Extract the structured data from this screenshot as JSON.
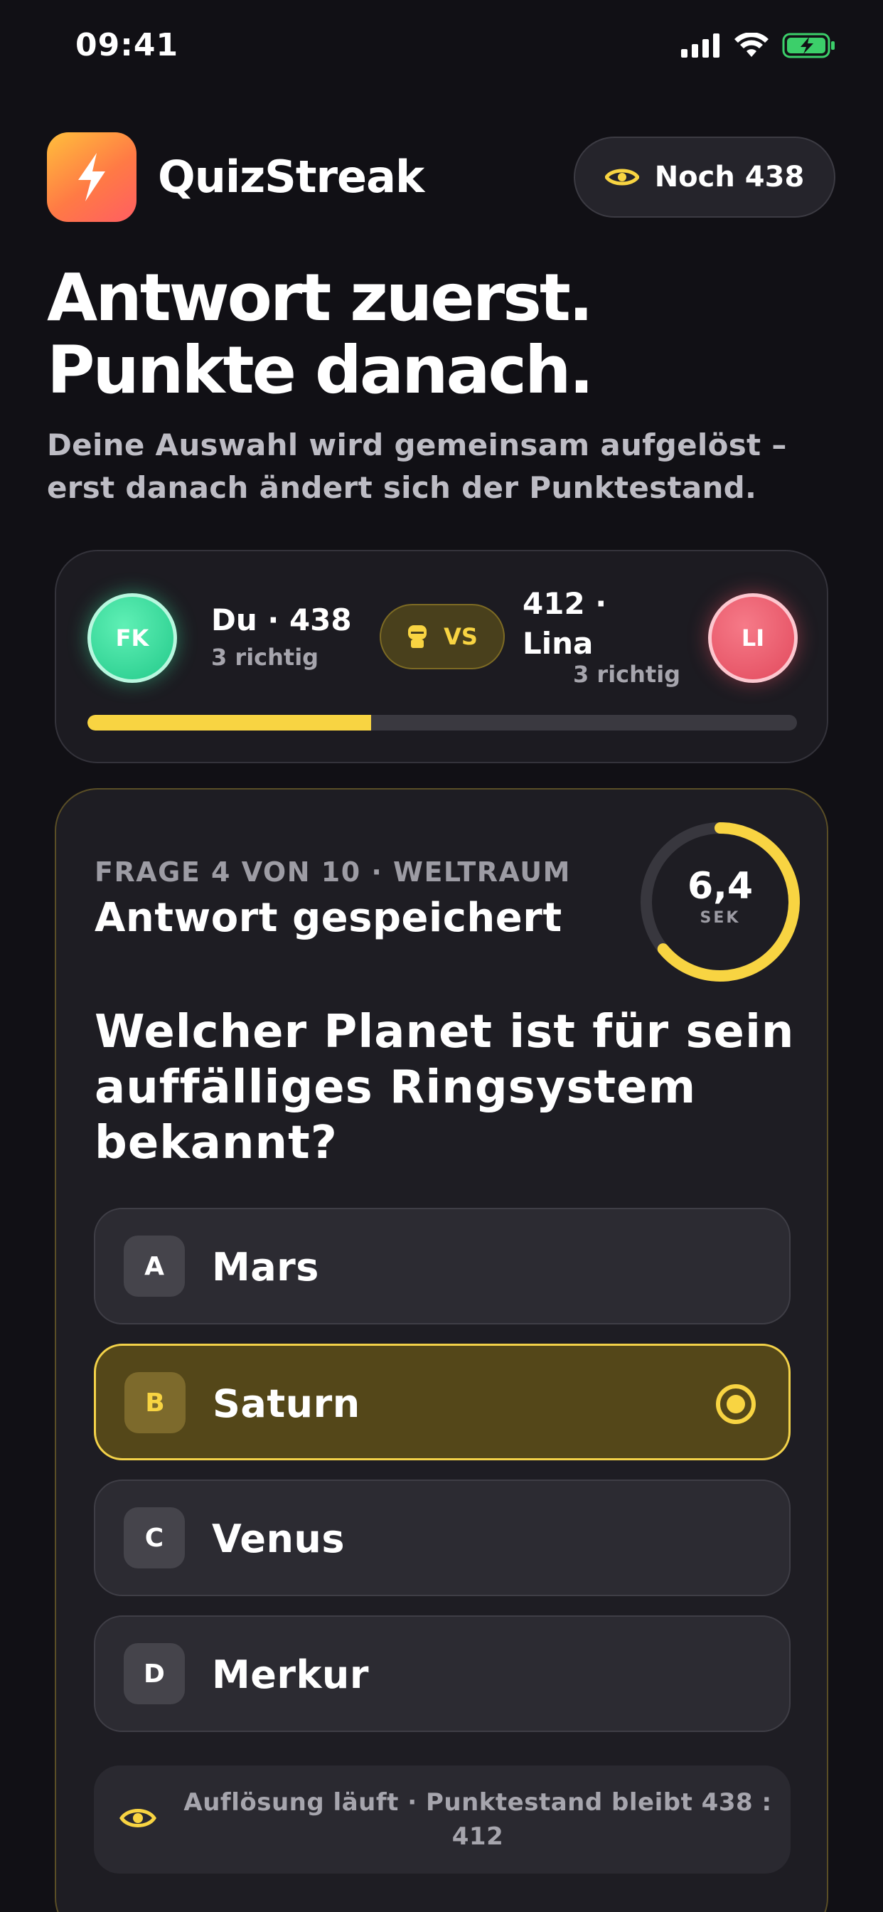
{
  "status_bar": {
    "time": "09:41"
  },
  "header": {
    "app_name": "QuizStreak",
    "remaining_label": "Noch 438"
  },
  "hero": {
    "title": "Antwort zuerst. Punkte danach.",
    "subtitle": "Deine Auswahl wird gemeinsam aufgelöst – erst danach ändert sich der Punktestand."
  },
  "scoreboard": {
    "me": {
      "initials": "FK",
      "name_score": "Du · 438",
      "correct": "3 richtig"
    },
    "vs_label": "VS",
    "opponent": {
      "initials": "LI",
      "name_score": "412 · Lina",
      "correct": "3 richtig"
    },
    "progress_fraction": 0.4,
    "colors": {
      "accent": "#f8d442",
      "me": "#2fd699",
      "opponent": "#ea5668"
    }
  },
  "question": {
    "meta": "FRAGE 4 VON 10 · WELTRAUM",
    "status": "Antwort gespeichert",
    "timer_value": "6,4",
    "timer_unit": "SEK",
    "timer_fraction": 0.64,
    "text": "Welcher Planet ist für sein auffälliges Ringsystem bekannt?",
    "answers": [
      {
        "letter": "A",
        "label": "Mars",
        "selected": false
      },
      {
        "letter": "B",
        "label": "Saturn",
        "selected": true
      },
      {
        "letter": "C",
        "label": "Venus",
        "selected": false
      },
      {
        "letter": "D",
        "label": "Merkur",
        "selected": false
      }
    ],
    "info": "Auflösung läuft · Punktestand bleibt 438 : 412"
  }
}
